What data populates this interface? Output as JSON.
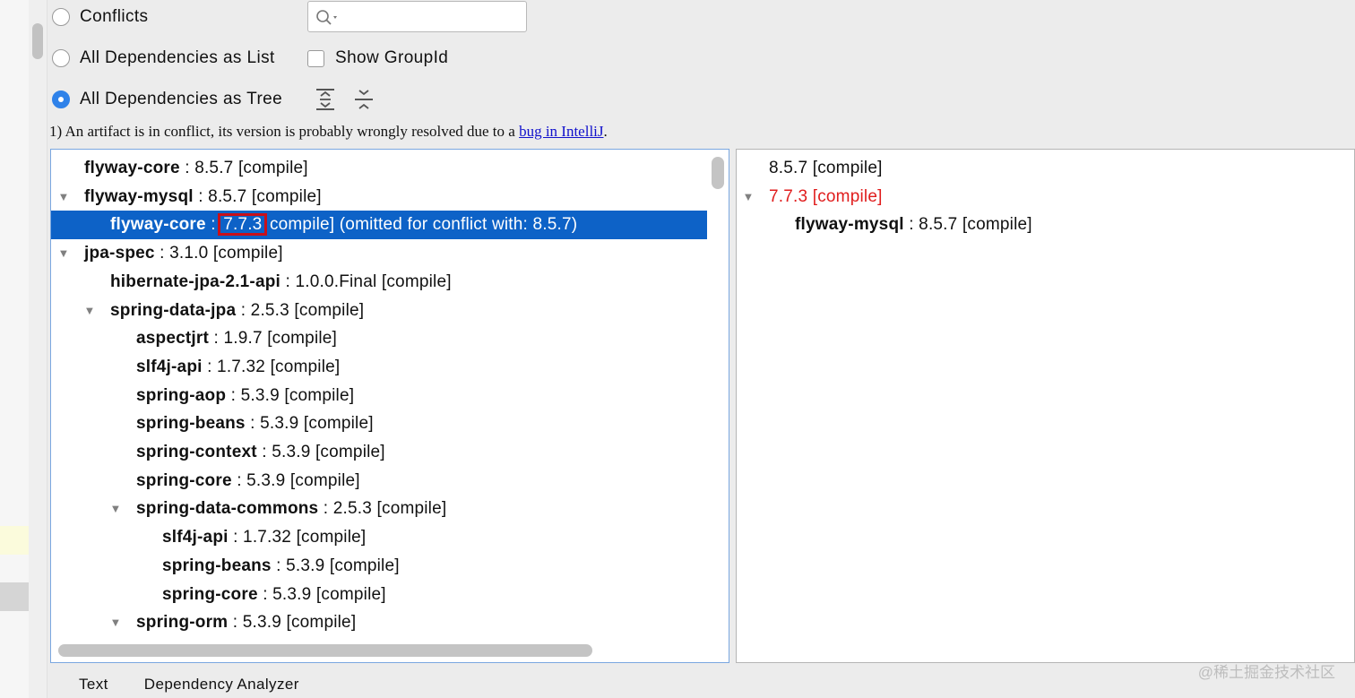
{
  "options": {
    "conflicts": "Conflicts",
    "list": "All Dependencies as List",
    "tree": "All Dependencies as Tree",
    "show_groupid": "Show GroupId",
    "selected": "tree"
  },
  "search": {
    "placeholder": "",
    "value": ""
  },
  "icons": {
    "search": "search-icon",
    "expand_all": "expand-all-icon",
    "collapse_all": "collapse-all-icon"
  },
  "note": {
    "prefix": "1) An artifact is in conflict, its version is probably wrongly resolved due to a ",
    "link": "bug in IntelliJ",
    "suffix": "."
  },
  "tree": [
    {
      "name": "flyway-core",
      "ver": "8.5.7",
      "scope": "[compile]"
    },
    {
      "name": "flyway-mysql",
      "ver": "8.5.7",
      "scope": "[compile]"
    },
    {
      "name": "flyway-core",
      "ver": "7.7.3",
      "scope": "compile]",
      "extra": "(omitted for conflict with: 8.5.7)"
    },
    {
      "name": "jpa-spec",
      "ver": "3.1.0",
      "scope": "[compile]"
    },
    {
      "name": "hibernate-jpa-2.1-api",
      "ver": "1.0.0.Final",
      "scope": "[compile]"
    },
    {
      "name": "spring-data-jpa",
      "ver": "2.5.3",
      "scope": "[compile]"
    },
    {
      "name": "aspectjrt",
      "ver": "1.9.7",
      "scope": "[compile]"
    },
    {
      "name": "slf4j-api",
      "ver": "1.7.32",
      "scope": "[compile]"
    },
    {
      "name": "spring-aop",
      "ver": "5.3.9",
      "scope": "[compile]"
    },
    {
      "name": "spring-beans",
      "ver": "5.3.9",
      "scope": "[compile]"
    },
    {
      "name": "spring-context",
      "ver": "5.3.9",
      "scope": "[compile]"
    },
    {
      "name": "spring-core",
      "ver": "5.3.9",
      "scope": "[compile]"
    },
    {
      "name": "spring-data-commons",
      "ver": "2.5.3",
      "scope": "[compile]"
    },
    {
      "name": "slf4j-api",
      "ver": "1.7.32",
      "scope": "[compile]"
    },
    {
      "name": "spring-beans",
      "ver": "5.3.9",
      "scope": "[compile]"
    },
    {
      "name": "spring-core",
      "ver": "5.3.9",
      "scope": "[compile]"
    },
    {
      "name": "spring-orm",
      "ver": "5.3.9",
      "scope": "[compile]"
    }
  ],
  "usages": [
    {
      "text": "8.5.7 [compile]"
    },
    {
      "text": "7.7.3 [compile]"
    },
    {
      "name": "flyway-mysql",
      "ver": "8.5.7",
      "scope": "[compile]"
    }
  ],
  "tabs": [
    "Text",
    "Dependency Analyzer"
  ],
  "watermark": "@稀土掘金技术社区",
  "colors": {
    "selection": "#0d62c7",
    "conflict": "#e01d1d",
    "highlight_box": "#c8101a",
    "link": "#1111cc"
  }
}
